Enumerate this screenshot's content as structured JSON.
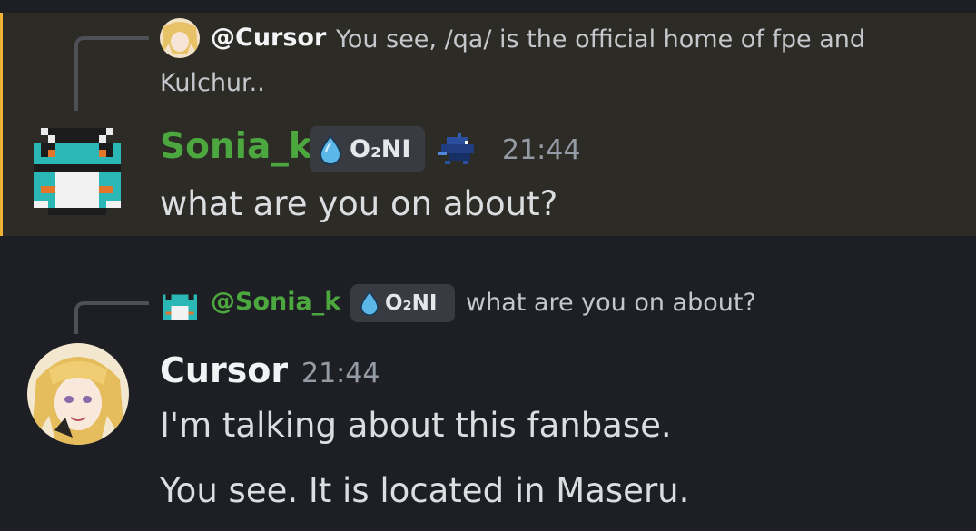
{
  "reply1": {
    "name": "@Cursor",
    "text": "You see, /qa/ is the official home of fpe and Kulchur.."
  },
  "msg1": {
    "username": "Sonia_k",
    "badge": "O₂NI",
    "timestamp": "21:44",
    "content": "what are you on  about?"
  },
  "reply2": {
    "name": "@Sonia_k",
    "badge": "O₂NI",
    "text": "what are you on  about?"
  },
  "msg2": {
    "username": "Cursor",
    "timestamp": "21:44",
    "lines": [
      "I'm talking about this fanbase.",
      "You see. It is located in Maseru."
    ]
  },
  "colors": {
    "highlight_bg": "#2d2b26",
    "highlight_bar": "#f0b232",
    "sonia_name": "#4ca73f",
    "cursor_name": "#f2f3f5"
  },
  "icons": [
    "pixel-frog-avatar",
    "anime-girl-avatar",
    "water-drop-icon",
    "blue-pixel-creature-icon"
  ]
}
